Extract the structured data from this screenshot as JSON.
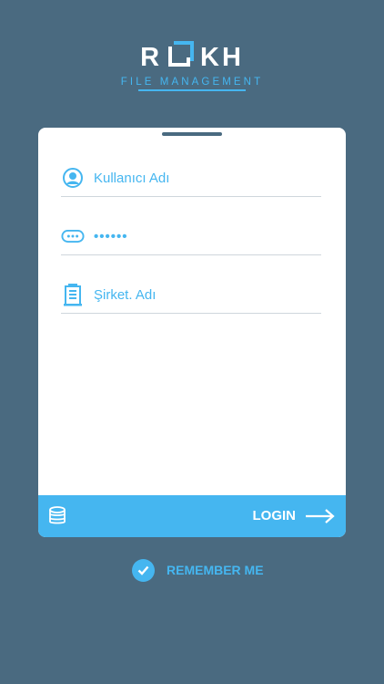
{
  "logo": {
    "letter_1": "R",
    "letters_end": "KH",
    "subtitle": "FILE MANAGEMENT"
  },
  "form": {
    "username": {
      "placeholder": "Kullanıcı Adı",
      "icon": "user-circle-icon"
    },
    "password": {
      "value": "••••••",
      "icon": "password-dots-icon"
    },
    "company": {
      "placeholder": "Şirket. Adı",
      "icon": "building-icon"
    }
  },
  "login_bar": {
    "label": "LOGIN",
    "left_icon": "database-icon",
    "right_icon": "arrow-right-icon"
  },
  "remember": {
    "label": "REMEMBER ME",
    "checked": true
  },
  "colors": {
    "background": "#4a6a80",
    "accent": "#45b6f0",
    "card": "#ffffff"
  }
}
